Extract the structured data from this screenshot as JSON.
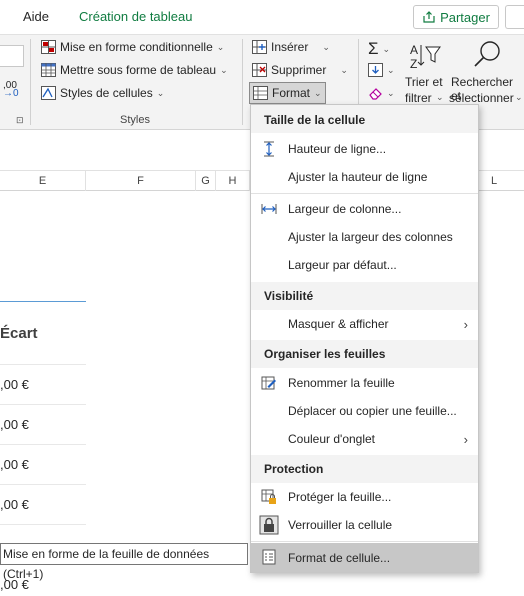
{
  "tabs": {
    "help": "Aide",
    "table_design": "Création de tableau"
  },
  "share_label": "Partager",
  "ribbon": {
    "styles": {
      "conditional": "Mise en forme conditionnelle",
      "as_table": "Mettre sous forme de tableau",
      "cell_styles": "Styles de cellules",
      "group_label": "Styles"
    },
    "cells": {
      "insert": "Insérer",
      "delete": "Supprimer",
      "format": "Format"
    },
    "editing": {
      "sort_line1": "Trier et",
      "sort_line2": "filtrer",
      "find_line1": "Rechercher et",
      "find_line2": "sélectionner"
    },
    "left_number": ",00",
    "left_arrow": "→0"
  },
  "columns": [
    "E",
    "F",
    "G",
    "H",
    "L"
  ],
  "sheet": {
    "header_fragment": "Écart",
    "values": [
      ",00 €",
      ",00 €",
      ",00 €",
      ",00 €",
      ",00 €"
    ]
  },
  "menu": {
    "sections": [
      {
        "title": "Taille de la cellule"
      },
      {
        "title": "Visibilité"
      },
      {
        "title": "Organiser les feuilles"
      },
      {
        "title": "Protection"
      }
    ],
    "items": {
      "row_height": "Hauteur de ligne...",
      "autofit_row": "Ajuster la hauteur de ligne",
      "col_width": "Largeur de colonne...",
      "autofit_col": "Ajuster la largeur des colonnes",
      "default_width": "Largeur par défaut...",
      "hide_show": "Masquer & afficher",
      "rename": "Renommer la feuille",
      "move_copy": "Déplacer ou copier une feuille...",
      "tab_color": "Couleur d'onglet",
      "protect": "Protéger la feuille...",
      "lock": "Verrouiller la cellule",
      "format_cells": "Format de cellule..."
    }
  },
  "tooltip": "Mise en forme de la feuille de données (Ctrl+1)",
  "colors": {
    "accent": "#107c41",
    "ribbon_bg": "#f3f3f3",
    "highlight": "#c7c7c7"
  }
}
